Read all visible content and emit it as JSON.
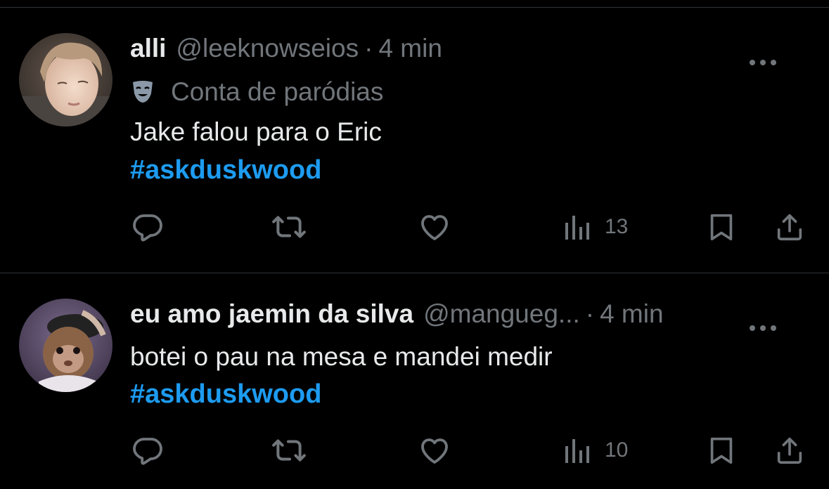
{
  "theme": {
    "background": "#000000",
    "text_primary": "#e7e9ea",
    "text_secondary": "#71767b",
    "link": "#1d9bf0",
    "divider": "#2f3336"
  },
  "tweets": [
    {
      "display_name": "alli",
      "handle": "@leeknowseios",
      "separator": "·",
      "time": "4 min",
      "parody_label": "Conta de paródias",
      "parody_icon": "theater-mask-icon",
      "text": "Jake falou para o Eric",
      "hashtag": "#askduskwood",
      "views": "13"
    },
    {
      "display_name": "eu amo jaemin da silva",
      "handle": "@mangueg...",
      "separator": "·",
      "time": "4 min",
      "text": "botei o pau na mesa e mandei medir",
      "hashtag": "#askduskwood",
      "views": "10"
    }
  ],
  "icons": {
    "reply": "reply-icon",
    "retweet": "retweet-icon",
    "like": "heart-icon",
    "views": "views-chart-icon",
    "bookmark": "bookmark-icon",
    "share": "share-icon",
    "more": "more-options-icon"
  }
}
